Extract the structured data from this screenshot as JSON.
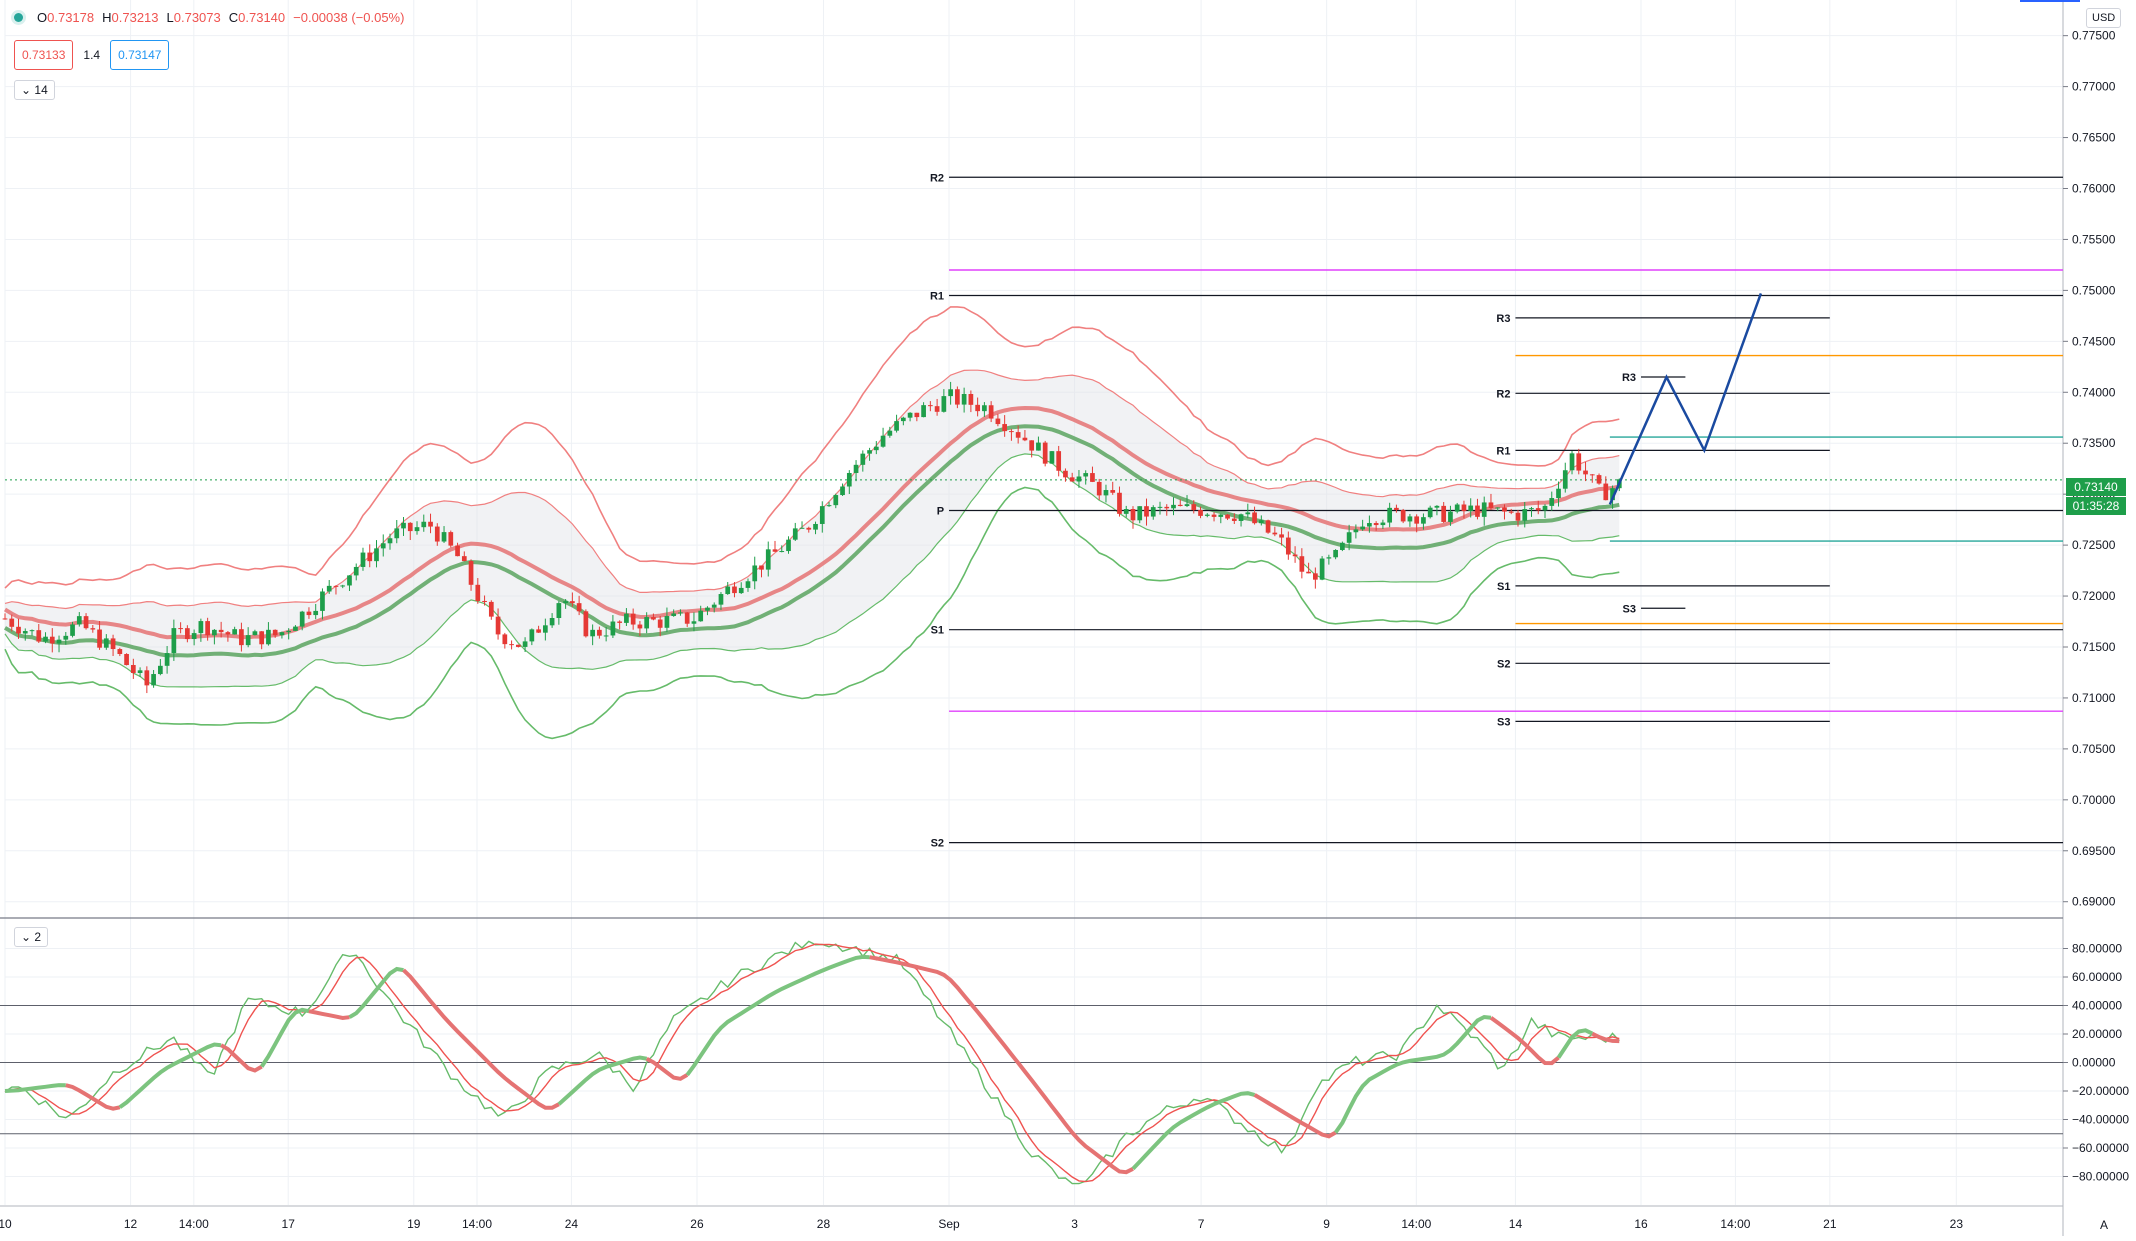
{
  "header": {
    "open_label": "O",
    "open": "0.73178",
    "high_label": "H",
    "high": "0.73213",
    "low_label": "L",
    "low": "0.73073",
    "close_label": "C",
    "close": "0.73140",
    "change": "−0.00038 (−0.05%)",
    "bid": "0.73133",
    "spread": "1.4",
    "ask": "0.73147",
    "length_toggle": "14"
  },
  "currency_badge": "USD",
  "last_price": {
    "value": "0.73140",
    "countdown": "01:35:28"
  },
  "lower_toggle": "2",
  "colors": {
    "up": "#1e9e4a",
    "down": "#e53935",
    "accent": "#1a4aa0",
    "band_red": "#f08080",
    "band_green": "#66bb6a"
  },
  "chart_data": {
    "type": "candlestick",
    "main_y_ticks": [
      "0.77500",
      "0.77000",
      "0.76500",
      "0.76000",
      "0.75500",
      "0.75000",
      "0.74500",
      "0.74000",
      "0.73500",
      "0.73000",
      "0.72500",
      "0.72000",
      "0.71500",
      "0.71000",
      "0.70500",
      "0.70000",
      "0.69500",
      "0.69000"
    ],
    "main_y_tick_values": [
      0.775,
      0.77,
      0.765,
      0.76,
      0.755,
      0.75,
      0.745,
      0.74,
      0.735,
      0.73,
      0.725,
      0.72,
      0.715,
      0.71,
      0.705,
      0.7,
      0.695,
      0.69
    ],
    "ylim": [
      0.6885,
      0.7785
    ],
    "osc_y_ticks": [
      "80.00000",
      "60.00000",
      "40.00000",
      "20.00000",
      "0.00000",
      "−20.00000",
      "−40.00000",
      "−60.00000",
      "−80.00000"
    ],
    "osc_y_tick_values": [
      80,
      60,
      40,
      20,
      0,
      -20,
      -40,
      -60,
      -80
    ],
    "osc_ylim": [
      -100,
      100
    ],
    "x_ticks": [
      {
        "label": "10",
        "t": 0.0
      },
      {
        "label": "12",
        "t": 1.33
      },
      {
        "label": "14:00",
        "t": 2.0
      },
      {
        "label": "17",
        "t": 3.0
      },
      {
        "label": "19",
        "t": 4.33
      },
      {
        "label": "14:00",
        "t": 5.0
      },
      {
        "label": "24",
        "t": 6.0
      },
      {
        "label": "26",
        "t": 7.33
      },
      {
        "label": "28",
        "t": 8.67
      },
      {
        "label": "Sep",
        "t": 10.0
      },
      {
        "label": "3",
        "t": 11.33
      },
      {
        "label": "7",
        "t": 12.67
      },
      {
        "label": "9",
        "t": 14.0
      },
      {
        "label": "14:00",
        "t": 14.95
      },
      {
        "label": "14",
        "t": 16.0
      },
      {
        "label": "16",
        "t": 17.33
      },
      {
        "label": "14:00",
        "t": 18.33
      },
      {
        "label": "21",
        "t": 19.33
      },
      {
        "label": "23",
        "t": 20.67
      }
    ],
    "x_range": [
      0,
      21.8
    ],
    "pivot_levels": [
      {
        "label": "R2",
        "value": 0.7611,
        "t0": 10.0,
        "t1": 21.8
      },
      {
        "label": "R1",
        "value": 0.7495,
        "t0": 10.0,
        "t1": 21.8
      },
      {
        "label": "P",
        "value": 0.7284,
        "t0": 10.0,
        "t1": 21.8
      },
      {
        "label": "S1",
        "value": 0.7167,
        "t0": 10.0,
        "t1": 21.8
      },
      {
        "label": "S2",
        "value": 0.6958,
        "t0": 10.0,
        "t1": 21.8
      },
      {
        "label": "R3",
        "value": 0.7473,
        "t0": 16.0,
        "t1": 19.33
      },
      {
        "label": "R2",
        "value": 0.7399,
        "t0": 16.0,
        "t1": 19.33
      },
      {
        "label": "R1",
        "value": 0.7343,
        "t0": 16.0,
        "t1": 19.33
      },
      {
        "label": "S1",
        "value": 0.721,
        "t0": 16.0,
        "t1": 19.33
      },
      {
        "label": "S2",
        "value": 0.7134,
        "t0": 16.0,
        "t1": 19.33
      },
      {
        "label": "S3",
        "value": 0.7077,
        "t0": 16.0,
        "t1": 19.33
      },
      {
        "label": "R3",
        "value": 0.7415,
        "t0": 17.33,
        "t1": 17.8
      },
      {
        "label": "S3",
        "value": 0.7188,
        "t0": 17.33,
        "t1": 17.8
      }
    ],
    "colored_levels": [
      {
        "value": 0.752,
        "t0": 10.0,
        "color": "#e040fb"
      },
      {
        "value": 0.7087,
        "t0": 10.0,
        "color": "#e040fb"
      },
      {
        "value": 0.7436,
        "t0": 16.0,
        "color": "#ff9800"
      },
      {
        "value": 0.7173,
        "t0": 16.0,
        "color": "#ff9800"
      },
      {
        "value": 0.7356,
        "t0": 17.0,
        "color": "#26a69a"
      },
      {
        "value": 0.7254,
        "t0": 17.0,
        "color": "#26a69a"
      }
    ],
    "projection": [
      [
        17.0,
        0.729
      ],
      [
        17.6,
        0.7415
      ],
      [
        18.0,
        0.7343
      ],
      [
        18.6,
        0.7497
      ]
    ],
    "price_anchors": [
      [
        0.0,
        0.7178
      ],
      [
        0.4,
        0.7158
      ],
      [
        0.8,
        0.7172
      ],
      [
        1.2,
        0.7142
      ],
      [
        1.5,
        0.7112
      ],
      [
        1.8,
        0.7162
      ],
      [
        2.1,
        0.7172
      ],
      [
        2.5,
        0.7158
      ],
      [
        2.9,
        0.7162
      ],
      [
        3.3,
        0.7195
      ],
      [
        3.7,
        0.7228
      ],
      [
        4.1,
        0.726
      ],
      [
        4.5,
        0.727
      ],
      [
        4.8,
        0.7238
      ],
      [
        5.2,
        0.7165
      ],
      [
        5.5,
        0.715
      ],
      [
        5.9,
        0.72
      ],
      [
        6.2,
        0.7162
      ],
      [
        6.6,
        0.7175
      ],
      [
        6.9,
        0.7175
      ],
      [
        7.3,
        0.7178
      ],
      [
        7.7,
        0.721
      ],
      [
        8.1,
        0.7238
      ],
      [
        8.5,
        0.7268
      ],
      [
        8.9,
        0.7318
      ],
      [
        9.3,
        0.7358
      ],
      [
        9.7,
        0.7382
      ],
      [
        10.0,
        0.7395
      ],
      [
        10.4,
        0.7385
      ],
      [
        10.8,
        0.7355
      ],
      [
        11.2,
        0.7325
      ],
      [
        11.6,
        0.7305
      ],
      [
        11.9,
        0.7278
      ],
      [
        12.3,
        0.7285
      ],
      [
        12.7,
        0.7285
      ],
      [
        13.1,
        0.728
      ],
      [
        13.5,
        0.7255
      ],
      [
        13.8,
        0.7218
      ],
      [
        14.1,
        0.7238
      ],
      [
        14.4,
        0.7278
      ],
      [
        14.8,
        0.728
      ],
      [
        15.2,
        0.728
      ],
      [
        15.6,
        0.7285
      ],
      [
        16.0,
        0.728
      ],
      [
        16.3,
        0.7285
      ],
      [
        16.6,
        0.7338
      ],
      [
        16.9,
        0.73
      ],
      [
        17.1,
        0.731
      ]
    ],
    "osc_anchors": [
      [
        0.0,
        -20
      ],
      [
        0.6,
        -15
      ],
      [
        1.1,
        -35
      ],
      [
        1.6,
        -5
      ],
      [
        2.2,
        15
      ],
      [
        2.6,
        -10
      ],
      [
        3.0,
        38
      ],
      [
        3.6,
        30
      ],
      [
        4.1,
        70
      ],
      [
        4.6,
        30
      ],
      [
        5.2,
        -10
      ],
      [
        5.7,
        -35
      ],
      [
        6.2,
        -5
      ],
      [
        6.7,
        5
      ],
      [
        7.1,
        -15
      ],
      [
        7.5,
        25
      ],
      [
        8.1,
        50
      ],
      [
        8.6,
        65
      ],
      [
        9.0,
        75
      ],
      [
        9.4,
        70
      ],
      [
        9.9,
        62
      ],
      [
        10.3,
        30
      ],
      [
        10.8,
        -12
      ],
      [
        11.3,
        -55
      ],
      [
        11.8,
        -80
      ],
      [
        12.3,
        -45
      ],
      [
        12.7,
        -30
      ],
      [
        13.1,
        -20
      ],
      [
        13.6,
        -40
      ],
      [
        14.0,
        -55
      ],
      [
        14.3,
        -15
      ],
      [
        14.7,
        0
      ],
      [
        15.2,
        5
      ],
      [
        15.6,
        35
      ],
      [
        16.0,
        15
      ],
      [
        16.3,
        -5
      ],
      [
        16.6,
        25
      ],
      [
        16.9,
        15
      ],
      [
        17.1,
        15
      ]
    ]
  }
}
